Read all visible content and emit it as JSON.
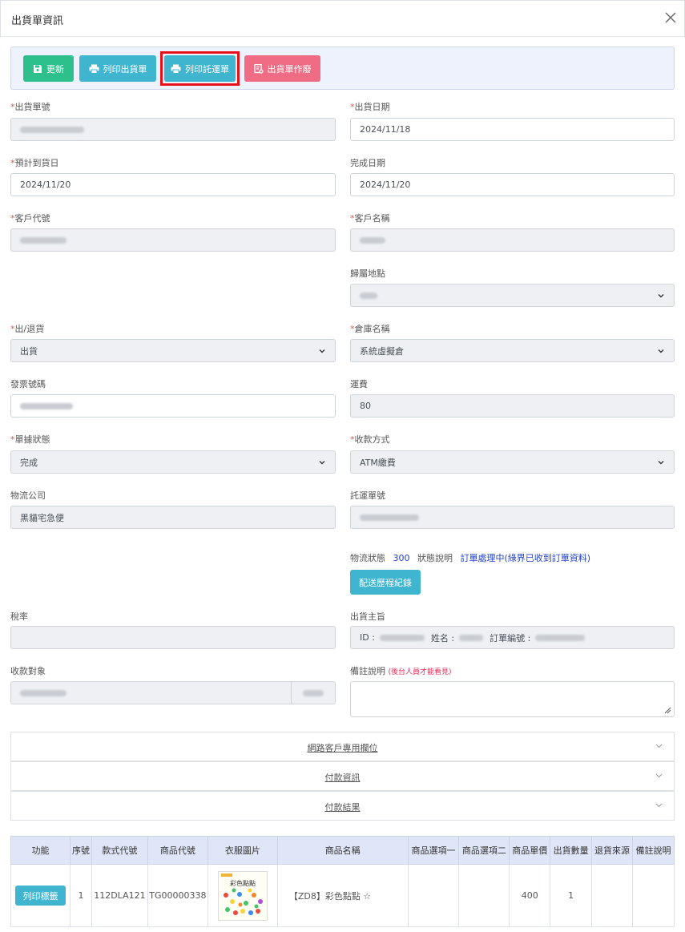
{
  "modal": {
    "title": "出貨單資訊"
  },
  "toolbar": {
    "update": "更新",
    "print_shipping": "列印出貨單",
    "print_consign": "列印託運單",
    "void_shipping": "出貨單作廢"
  },
  "form": {
    "shipping_no_label": "出貨單號",
    "ship_date_label": "出貨日期",
    "ship_date_value": "2024/11/18",
    "est_arrival_label": "預計到貨日",
    "est_arrival_value": "2024/11/20",
    "finish_date_label": "完成日期",
    "finish_date_value": "2024/11/20",
    "customer_code_label": "客戶代號",
    "customer_name_label": "客戶名稱",
    "location_label": "歸屬地點",
    "in_out_label": "出/退貨",
    "in_out_value": "出貨",
    "warehouse_label": "倉庫名稱",
    "warehouse_value": "系統虛擬倉",
    "invoice_label": "發票號碼",
    "freight_label": "運費",
    "freight_value": "80",
    "doc_status_label": "單據狀態",
    "doc_status_value": "完成",
    "payment_label": "收款方式",
    "payment_value": "ATM繳費",
    "logistics_label": "物流公司",
    "logistics_value": "黑貓宅急便",
    "tracking_label": "託運單號",
    "logistics_status_label": "物流狀態",
    "logistics_status_value": "300",
    "status_desc_label": "狀態說明",
    "status_desc_value": "訂單處理中(綠界已收到訂單資料)",
    "delivery_history": "配送歷程紀錄",
    "tax_label": "稅率",
    "ship_subject_label": "出貨主旨",
    "subject_id_prefix": "ID :",
    "subject_name_prefix": "姓名 :",
    "subject_order_prefix": "訂單編號 :",
    "payee_label": "收款對象",
    "remark_label": "備註說明",
    "remark_note": "(後台人員才能看見)"
  },
  "accordions": [
    "網路客戶專用欄位",
    "付款資訊",
    "付款結果"
  ],
  "table": {
    "headers": [
      "功能",
      "序號",
      "款式代號",
      "商品代號",
      "衣服圖片",
      "商品名稱",
      "商品選項一",
      "商品選項二",
      "商品單價",
      "出貨數量",
      "退貨來源",
      "備註說明"
    ],
    "row": {
      "action": "列印標籤",
      "seq": "1",
      "style_code": "112DLA121",
      "product_code": "TG00000338",
      "image_title": "彩色點點",
      "product_name": "【ZD8】彩色點點 ☆",
      "option1": "",
      "option2": "",
      "price": "400",
      "qty": "1",
      "return_source": "",
      "remark": ""
    }
  },
  "colors": {
    "green": "#2dc08d",
    "teal": "#3fb5d0",
    "red": "#f06b84",
    "highlight": "#e8101a",
    "blue_text": "#1f3fc9"
  }
}
